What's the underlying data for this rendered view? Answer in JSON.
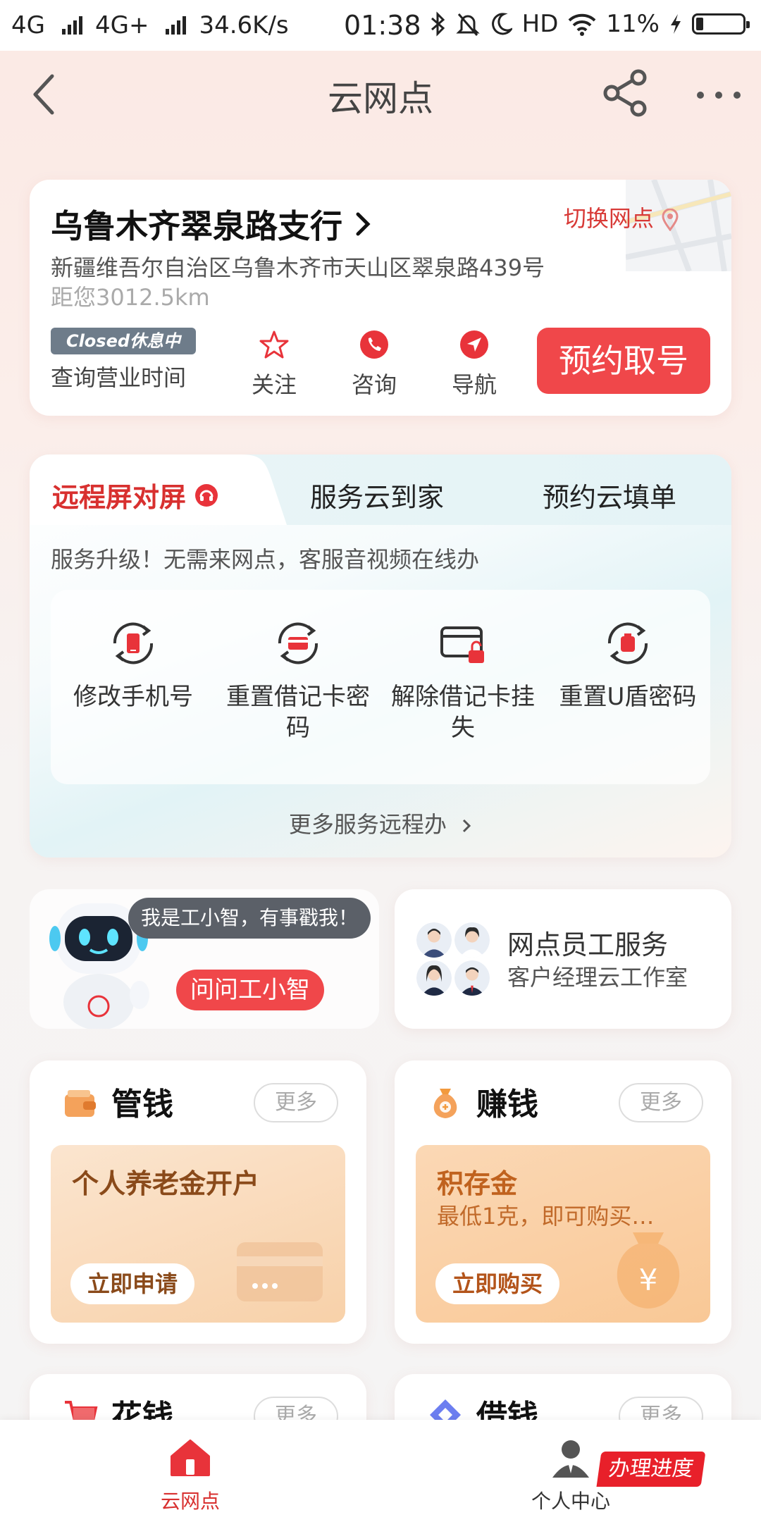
{
  "status_bar": {
    "net1": "4G",
    "net2": "4G+",
    "speed": "34.6K/s",
    "time": "01:38",
    "hd": "HD",
    "battery": "11%"
  },
  "nav": {
    "title": "云网点"
  },
  "branch": {
    "name": "乌鲁木齐翠泉路支行",
    "switch_label": "切换网点",
    "address": "新疆维吾尔自治区乌鲁木齐市天山区翠泉路439号",
    "distance": "距您3012.5km",
    "closed_badge": "Closed休息中",
    "hours_label": "查询营业时间",
    "actions": [
      {
        "label": "关注",
        "icon": "star-icon"
      },
      {
        "label": "咨询",
        "icon": "phone-icon"
      },
      {
        "label": "导航",
        "icon": "navigation-icon"
      }
    ],
    "book_label": "预约取号"
  },
  "remote": {
    "tabs": [
      "远程屏对屏",
      "服务云到家",
      "预约云填单"
    ],
    "description": "服务升级！无需来网点，客服音视频在线办",
    "services": [
      {
        "label": "修改手机号",
        "icon": "phone-change-icon"
      },
      {
        "label": "重置借记卡密码",
        "icon": "card-reset-icon"
      },
      {
        "label": "解除借记卡挂失",
        "icon": "card-unlock-icon"
      },
      {
        "label": "重置U盾密码",
        "icon": "ukey-reset-icon"
      }
    ],
    "more_label": "更多服务远程办"
  },
  "assistant": {
    "bubble": "我是工小智，有事戳我！",
    "ask_label": "问问工小智"
  },
  "staff": {
    "title": "网点员工服务",
    "subtitle": "客户经理云工作室"
  },
  "money_cards": [
    {
      "title": "管钱",
      "more": "更多",
      "icon": "wallet-icon",
      "promo_title": "个人养老金开户",
      "promo_sub": "",
      "promo_button": "立即申请"
    },
    {
      "title": "赚钱",
      "more": "更多",
      "icon": "money-bag-icon",
      "promo_title": "积存金",
      "promo_sub": "最低1克，即可购买…",
      "promo_button": "立即购买"
    },
    {
      "title": "花钱",
      "more": "更多",
      "icon": "cart-icon"
    },
    {
      "title": "借钱",
      "more": "更多",
      "icon": "diamond-icon"
    }
  ],
  "bottom_tabs": [
    {
      "label": "云网点",
      "icon": "home-icon",
      "active": true
    },
    {
      "label": "个人中心",
      "icon": "person-icon",
      "active": false
    }
  ],
  "progress_badge": "办理进度",
  "colors": {
    "brand_red": "#f0474a",
    "tab_red": "#d8302f"
  }
}
